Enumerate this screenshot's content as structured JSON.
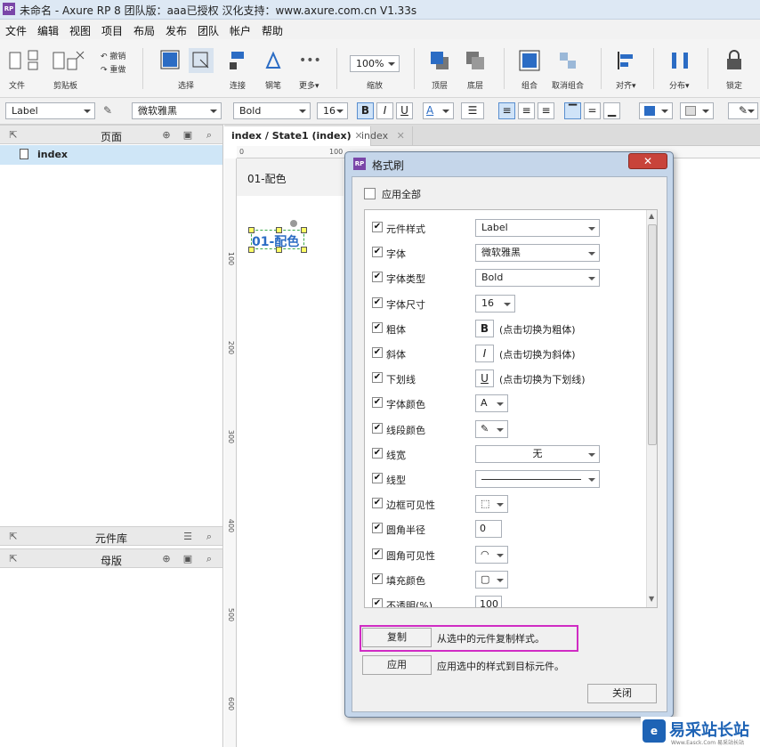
{
  "window": {
    "title": "未命名 - Axure RP 8 团队版：aaa已授权 汉化支持：www.axure.com.cn V1.33s",
    "app_icon": "RP"
  },
  "menu": [
    "文件",
    "编辑",
    "视图",
    "项目",
    "布局",
    "发布",
    "团队",
    "帐户",
    "帮助"
  ],
  "toolbar": {
    "file": "文件",
    "clipboard": "剪贴板",
    "undo": "撤销",
    "redo": "重做",
    "select": "选择",
    "connect": "连接",
    "pen": "钢笔",
    "more": "更多▾",
    "zoom": "100%",
    "zoom_label": "缩放",
    "top": "顶层",
    "bottom": "底层",
    "group": "组合",
    "ungroup": "取消组合",
    "align": "对齐▾",
    "distribute": "分布▾",
    "lock": "锁定"
  },
  "format": {
    "style": "Label",
    "font": "微软雅黑",
    "weight": "Bold",
    "size": "16",
    "bold": "B",
    "italic": "I",
    "underline": "U"
  },
  "panels": {
    "pages": "页面",
    "page_item": "index",
    "library": "元件库",
    "masters": "母版"
  },
  "tabs": {
    "active": "index / State1 (index)",
    "second": "index"
  },
  "canvas": {
    "text1": "01-配色",
    "widget_text": "01-配色",
    "ruler_h": [
      "0",
      "100"
    ],
    "ruler_v": [
      "100",
      "200",
      "300",
      "400",
      "500",
      "600"
    ]
  },
  "dialog": {
    "title": "格式刷",
    "icon": "RP",
    "apply_all": "应用全部",
    "rows": [
      {
        "label": "元件样式",
        "type": "select",
        "value": "Label"
      },
      {
        "label": "字体",
        "type": "select",
        "value": "微软雅黑"
      },
      {
        "label": "字体类型",
        "type": "select",
        "value": "Bold"
      },
      {
        "label": "字体尺寸",
        "type": "select-small",
        "value": "16"
      },
      {
        "label": "粗体",
        "type": "btn",
        "btn": "B",
        "hint": "(点击切换为粗体)"
      },
      {
        "label": "斜体",
        "type": "btn",
        "btn": "I",
        "hint": "(点击切换为斜体)"
      },
      {
        "label": "下划线",
        "type": "btn",
        "btn": "U",
        "hint": "(点击切换为下划线)"
      },
      {
        "label": "字体颜色",
        "type": "color",
        "btn": "A"
      },
      {
        "label": "线段颜色",
        "type": "color",
        "btn": "✎"
      },
      {
        "label": "线宽",
        "type": "select-center",
        "value": "无"
      },
      {
        "label": "线型",
        "type": "line"
      },
      {
        "label": "边框可见性",
        "type": "color",
        "btn": "⬚"
      },
      {
        "label": "圆角半径",
        "type": "input",
        "value": "0"
      },
      {
        "label": "圆角可见性",
        "type": "color",
        "btn": "◠"
      },
      {
        "label": "填充颜色",
        "type": "color",
        "btn": "▢"
      },
      {
        "label": "不透明(%)",
        "type": "input",
        "value": "100"
      }
    ],
    "copy_btn": "复制",
    "copy_desc": "从选中的元件复制样式。",
    "apply_btn": "应用",
    "apply_desc": "应用选中的样式到目标元件。",
    "close_btn": "关闭"
  },
  "watermark": {
    "brand": "易采站长站",
    "sub": "Www.Easck.Com 易采站长站"
  },
  "colors": {
    "accent": "#2b6cc4",
    "highlight": "#d02cc4"
  }
}
